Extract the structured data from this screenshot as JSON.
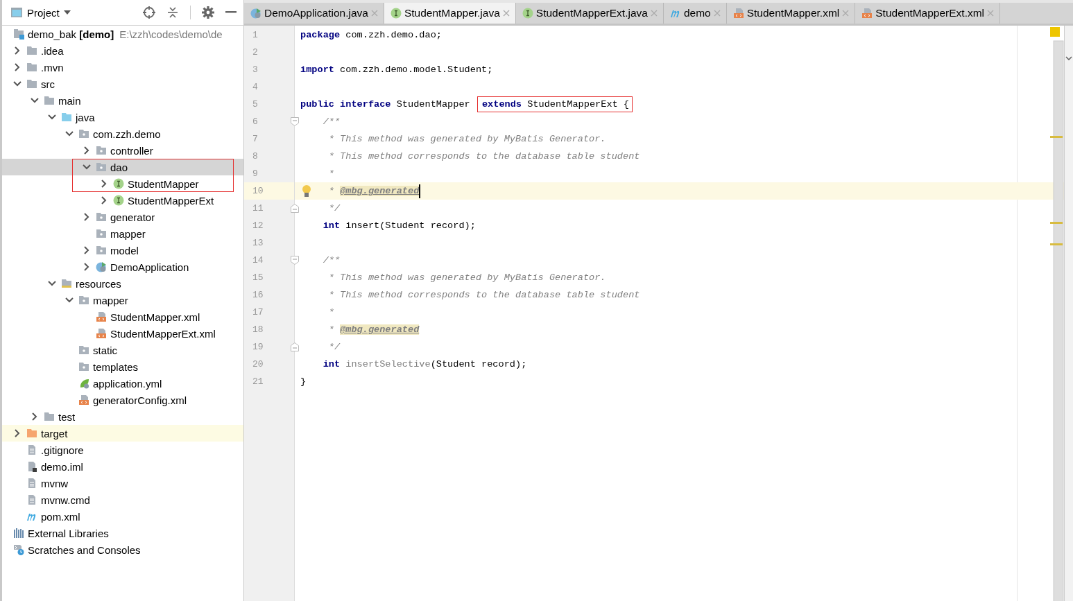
{
  "project_panel": {
    "title": "Project",
    "tree": [
      {
        "label": "demo_bak **[demo]**",
        "hint": "E:\\zzh\\codes\\demo\\de",
        "kind": "module",
        "expanded": true,
        "selected": false,
        "highlighted": false,
        "children": [
          {
            "label": ".idea",
            "kind": "folder",
            "expanded": false,
            "selected": false,
            "highlighted": false
          },
          {
            "label": ".mvn",
            "kind": "folder",
            "expanded": false,
            "selected": false,
            "highlighted": false
          },
          {
            "label": "src",
            "kind": "folder",
            "expanded": true,
            "selected": false,
            "highlighted": false,
            "children": [
              {
                "label": "main",
                "kind": "folder",
                "expanded": true,
                "selected": false,
                "highlighted": false,
                "children": [
                  {
                    "label": "java",
                    "kind": "source-folder",
                    "expanded": true,
                    "selected": false,
                    "highlighted": false,
                    "children": [
                      {
                        "label": "com.zzh.demo",
                        "kind": "package",
                        "expanded": true,
                        "selected": false,
                        "highlighted": false,
                        "children": [
                          {
                            "label": "controller",
                            "kind": "package",
                            "expanded": false,
                            "selected": false,
                            "highlighted": false
                          },
                          {
                            "label": "dao",
                            "kind": "package",
                            "expanded": true,
                            "selected": true,
                            "highlighted": false,
                            "boxed": true,
                            "children": [
                              {
                                "label": "StudentMapper",
                                "kind": "interface",
                                "expanded": false,
                                "selected": false,
                                "highlighted": false,
                                "boxed": true
                              },
                              {
                                "label": "StudentMapperExt",
                                "kind": "interface",
                                "expanded": false,
                                "selected": false,
                                "highlighted": false
                              }
                            ]
                          },
                          {
                            "label": "generator",
                            "kind": "package",
                            "expanded": false,
                            "selected": false,
                            "highlighted": false
                          },
                          {
                            "label": "mapper",
                            "kind": "package",
                            "selected": false,
                            "highlighted": false
                          },
                          {
                            "label": "model",
                            "kind": "package",
                            "expanded": false,
                            "selected": false,
                            "highlighted": false
                          },
                          {
                            "label": "DemoApplication",
                            "kind": "spring-app",
                            "expanded": false,
                            "selected": false,
                            "highlighted": false
                          }
                        ]
                      }
                    ]
                  },
                  {
                    "label": "resources",
                    "kind": "resources-folder",
                    "expanded": true,
                    "selected": false,
                    "highlighted": false,
                    "children": [
                      {
                        "label": "mapper",
                        "kind": "package",
                        "expanded": true,
                        "selected": false,
                        "highlighted": false,
                        "children": [
                          {
                            "label": "StudentMapper.xml",
                            "kind": "xml",
                            "selected": false,
                            "highlighted": false
                          },
                          {
                            "label": "StudentMapperExt.xml",
                            "kind": "xml",
                            "selected": false,
                            "highlighted": false
                          }
                        ]
                      },
                      {
                        "label": "static",
                        "kind": "package",
                        "selected": false,
                        "highlighted": false
                      },
                      {
                        "label": "templates",
                        "kind": "package",
                        "selected": false,
                        "highlighted": false
                      },
                      {
                        "label": "application.yml",
                        "kind": "yml",
                        "selected": false,
                        "highlighted": false
                      },
                      {
                        "label": "generatorConfig.xml",
                        "kind": "xml",
                        "selected": false,
                        "highlighted": false
                      }
                    ]
                  }
                ]
              },
              {
                "label": "test",
                "kind": "folder",
                "expanded": false,
                "selected": false,
                "highlighted": false
              }
            ]
          },
          {
            "label": "target",
            "kind": "excluded-folder",
            "expanded": false,
            "selected": false,
            "highlighted": true
          },
          {
            "label": ".gitignore",
            "kind": "file",
            "selected": false,
            "highlighted": false
          },
          {
            "label": "demo.iml",
            "kind": "iml",
            "selected": false,
            "highlighted": false
          },
          {
            "label": "mvnw",
            "kind": "file",
            "selected": false,
            "highlighted": false
          },
          {
            "label": "mvnw.cmd",
            "kind": "file",
            "selected": false,
            "highlighted": false
          },
          {
            "label": "pom.xml",
            "kind": "maven",
            "selected": false,
            "highlighted": false
          }
        ]
      },
      {
        "label": "External Libraries",
        "kind": "libraries",
        "selected": false,
        "highlighted": false
      },
      {
        "label": "Scratches and Consoles",
        "kind": "scratches",
        "selected": false,
        "highlighted": false
      }
    ]
  },
  "editor": {
    "tabs": [
      {
        "label": "DemoApplication.java",
        "kind": "spring-app",
        "selected": false
      },
      {
        "label": "StudentMapper.java",
        "kind": "interface",
        "selected": true
      },
      {
        "label": "StudentMapperExt.java",
        "kind": "interface",
        "selected": false
      },
      {
        "label": "demo",
        "kind": "maven",
        "selected": false
      },
      {
        "label": "StudentMapper.xml",
        "kind": "xml",
        "selected": false
      },
      {
        "label": "StudentMapperExt.xml",
        "kind": "xml",
        "selected": false
      }
    ],
    "lines": [
      {
        "number": "1",
        "tokens": [
          {
            "kind": "keyword",
            "text": "package"
          },
          {
            "kind": "plain",
            "text": " com.zzh.demo.dao;"
          }
        ]
      },
      {
        "number": "2"
      },
      {
        "number": "3",
        "tokens": [
          {
            "kind": "keyword",
            "text": "import"
          },
          {
            "kind": "plain",
            "text": " com.zzh.demo.model.Student;"
          }
        ]
      },
      {
        "number": "4"
      },
      {
        "number": "5",
        "tokens": [
          {
            "kind": "keyword",
            "text": "public interface"
          },
          {
            "kind": "plain",
            "text": " StudentMapper "
          },
          {
            "kind": "keyword",
            "text": "extends",
            "boxed": true
          },
          {
            "kind": "plain",
            "text": " StudentMapperExt {",
            "boxed": true
          }
        ]
      },
      {
        "number": "6",
        "fold_start": true,
        "tokens": [
          {
            "kind": "comment",
            "text": "    /**"
          }
        ]
      },
      {
        "number": "7",
        "tokens": [
          {
            "kind": "comment",
            "text": "     * This method was generated by MyBatis Generator."
          }
        ]
      },
      {
        "number": "8",
        "tokens": [
          {
            "kind": "comment",
            "text": "     * This method corresponds to the database table student"
          }
        ]
      },
      {
        "number": "9",
        "tokens": [
          {
            "kind": "comment",
            "text": "     *"
          }
        ]
      },
      {
        "number": "10",
        "current": true,
        "bulb": true,
        "cursor": true,
        "tokens": [
          {
            "kind": "comment",
            "text": "     * "
          },
          {
            "kind": "doctag",
            "text": "@mbg.generated"
          }
        ]
      },
      {
        "number": "11",
        "fold_end": true,
        "tokens": [
          {
            "kind": "comment",
            "text": "     */"
          }
        ]
      },
      {
        "number": "12",
        "tokens": [
          {
            "kind": "keyword",
            "text": "    int"
          },
          {
            "kind": "plain",
            "text": " insert(Student record);"
          }
        ]
      },
      {
        "number": "13"
      },
      {
        "number": "14",
        "fold_start": true,
        "tokens": [
          {
            "kind": "comment",
            "text": "    /**"
          }
        ]
      },
      {
        "number": "15",
        "tokens": [
          {
            "kind": "comment",
            "text": "     * This method was generated by MyBatis Generator."
          }
        ]
      },
      {
        "number": "16",
        "tokens": [
          {
            "kind": "comment",
            "text": "     * This method corresponds to the database table student"
          }
        ]
      },
      {
        "number": "17",
        "tokens": [
          {
            "kind": "comment",
            "text": "     *"
          }
        ]
      },
      {
        "number": "18",
        "tokens": [
          {
            "kind": "comment",
            "text": "     * "
          },
          {
            "kind": "doctag",
            "text": "@mbg.generated"
          }
        ]
      },
      {
        "number": "19",
        "fold_end": true,
        "tokens": [
          {
            "kind": "comment",
            "text": "     */"
          }
        ]
      },
      {
        "number": "20",
        "tokens": [
          {
            "kind": "keyword",
            "text": "    int "
          },
          {
            "kind": "unused",
            "text": "insertSelective"
          },
          {
            "kind": "plain",
            "text": "(Student record);"
          }
        ]
      },
      {
        "number": "21",
        "tokens": [
          {
            "kind": "plain",
            "text": "}"
          }
        ]
      }
    ]
  }
}
